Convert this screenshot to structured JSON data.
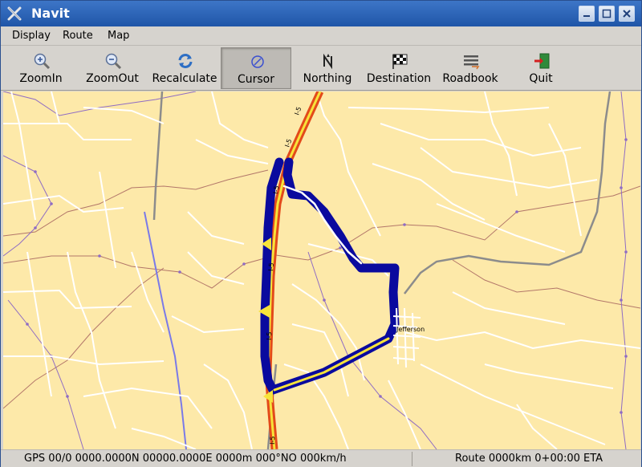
{
  "window": {
    "title": "Navit",
    "icon": "navit-x-icon"
  },
  "menu": {
    "items": [
      {
        "label": "Display"
      },
      {
        "label": "Route"
      },
      {
        "label": "Map"
      }
    ]
  },
  "toolbar": {
    "buttons": [
      {
        "label": "ZoomIn",
        "icon": "zoom-in-icon"
      },
      {
        "label": "ZoomOut",
        "icon": "zoom-out-icon"
      },
      {
        "label": "Recalculate",
        "icon": "refresh-icon"
      },
      {
        "label": "Cursor",
        "icon": "cursor-icon",
        "active": true
      },
      {
        "label": "Northing",
        "icon": "north-icon"
      },
      {
        "label": "Destination",
        "icon": "checkered-flag-icon"
      },
      {
        "label": "Roadbook",
        "icon": "list-icon"
      },
      {
        "label": "Quit",
        "icon": "exit-door-icon"
      }
    ]
  },
  "map": {
    "city_label": "Jefferson",
    "highway_labels": [
      "I-5",
      "I-5",
      "I-5",
      "I-5",
      "I-5",
      "I-5"
    ],
    "colors": {
      "land": "#fde9a9",
      "road": "#ffffff",
      "route": "#0a0a9e",
      "highway_outer": "#e34a1a",
      "highway_inner": "#f7e33a",
      "rail": "#8c8c8c",
      "boundary": "#a05a5a",
      "river": "#7a7ae8"
    }
  },
  "status": {
    "gps": "GPS 00/0 0000.0000N 00000.0000E 0000m 000°NO 000km/h",
    "route": "Route 0000km  0+00:00 ETA"
  }
}
